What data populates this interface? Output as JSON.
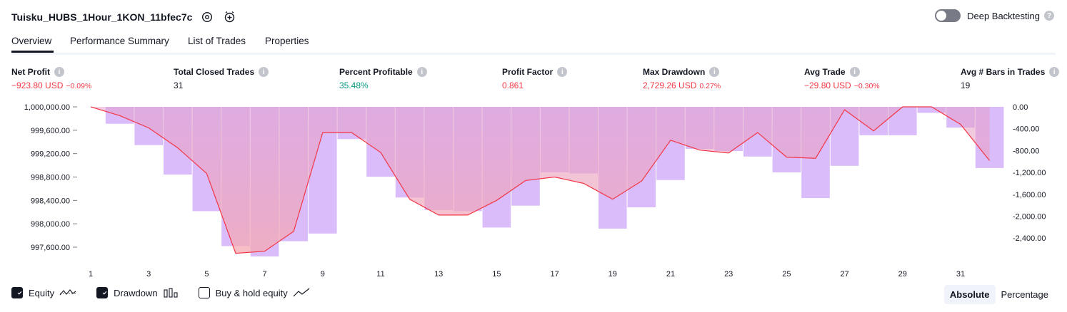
{
  "header": {
    "strategy_name": "Tuisku_HUBS_1Hour_1KON_11bfec7c",
    "deep_backtesting_label": "Deep Backtesting"
  },
  "tabs": [
    {
      "label": "Overview"
    },
    {
      "label": "Performance Summary"
    },
    {
      "label": "List of Trades"
    },
    {
      "label": "Properties"
    }
  ],
  "metrics": [
    {
      "label": "Net Profit",
      "value": "−923.80 USD",
      "sub": "−0.09%"
    },
    {
      "label": "Total Closed Trades",
      "value": "31",
      "sub": ""
    },
    {
      "label": "Percent Profitable",
      "value": "35.48%",
      "sub": ""
    },
    {
      "label": "Profit Factor",
      "value": "0.861",
      "sub": ""
    },
    {
      "label": "Max Drawdown",
      "value": "2,729.26 USD",
      "sub": "0.27%"
    },
    {
      "label": "Avg Trade",
      "value": "−29.80 USD",
      "sub": "−0.30%"
    },
    {
      "label": "Avg # Bars in Trades",
      "value": "19",
      "sub": ""
    }
  ],
  "colors": {
    "negative": "#f23645",
    "positive": "#089981",
    "equity_line": "#f23645",
    "drawdown_bar": "#d9b8fa"
  },
  "chart_data": {
    "type": "line",
    "x_ticks": [
      "1",
      "3",
      "5",
      "7",
      "9",
      "11",
      "13",
      "15",
      "17",
      "19",
      "21",
      "23",
      "25",
      "27",
      "29",
      "31"
    ],
    "left_ticks": [
      "1,000,000.00",
      "999,600.00",
      "999,200.00",
      "998,800.00",
      "998,400.00",
      "998,000.00",
      "997,600.00"
    ],
    "right_ticks": [
      "0.00",
      "-400.00",
      "-800.00",
      "-1,200.00",
      "-1,600.00",
      "-2,000.00",
      "-2,400.00"
    ],
    "left_ylim": [
      997400,
      1000000
    ],
    "right_ylim": [
      -2729.26,
      0
    ],
    "series": [
      {
        "name": "Equity",
        "x": [
          1,
          2,
          3,
          4,
          5,
          6,
          7,
          8,
          9,
          10,
          11,
          12,
          13,
          14,
          15,
          16,
          17,
          18,
          19,
          20,
          21,
          22,
          23,
          24,
          25,
          26,
          27,
          28,
          29,
          30,
          31,
          32
        ],
        "values": [
          1000000.0,
          999850.0,
          999640.0,
          999300.0,
          998860.0,
          997495.0,
          997530.0,
          997870.0,
          999560.0,
          999560.0,
          999220.0,
          998420.0,
          998150.0,
          998150.0,
          998400.0,
          998740.0,
          998800.0,
          998690.0,
          998420.0,
          998730.0,
          999430.0,
          999260.0,
          999210.0,
          999560.0,
          999140.0,
          999120.0,
          999950.0,
          999590.0,
          1000000.0,
          1000000.0,
          999700.0,
          999080.0
        ]
      },
      {
        "name": "Drawdown",
        "x": [
          1,
          2,
          3,
          4,
          5,
          6,
          7,
          8,
          9,
          10,
          11,
          12,
          13,
          14,
          15,
          16,
          17,
          18,
          19,
          20,
          21,
          22,
          23,
          24,
          25,
          26,
          27,
          28,
          29,
          30,
          31,
          32
        ],
        "values": [
          0,
          -310,
          -700,
          -1240,
          -1910,
          -2550,
          -2740,
          -2460,
          -2320,
          -590,
          -1280,
          -1660,
          -1890,
          -1910,
          -2210,
          -1810,
          -1200,
          -1220,
          -2230,
          -1840,
          -1340,
          -770,
          -810,
          -910,
          -1200,
          -1670,
          -1080,
          -520,
          -520,
          -110,
          -380,
          -1120
        ]
      }
    ],
    "legend": [
      {
        "label": "Equity",
        "checked": true
      },
      {
        "label": "Drawdown",
        "checked": true
      },
      {
        "label": "Buy & hold equity",
        "checked": false
      }
    ],
    "grid": false
  },
  "view_toggle": {
    "absolute_label": "Absolute",
    "percentage_label": "Percentage"
  }
}
